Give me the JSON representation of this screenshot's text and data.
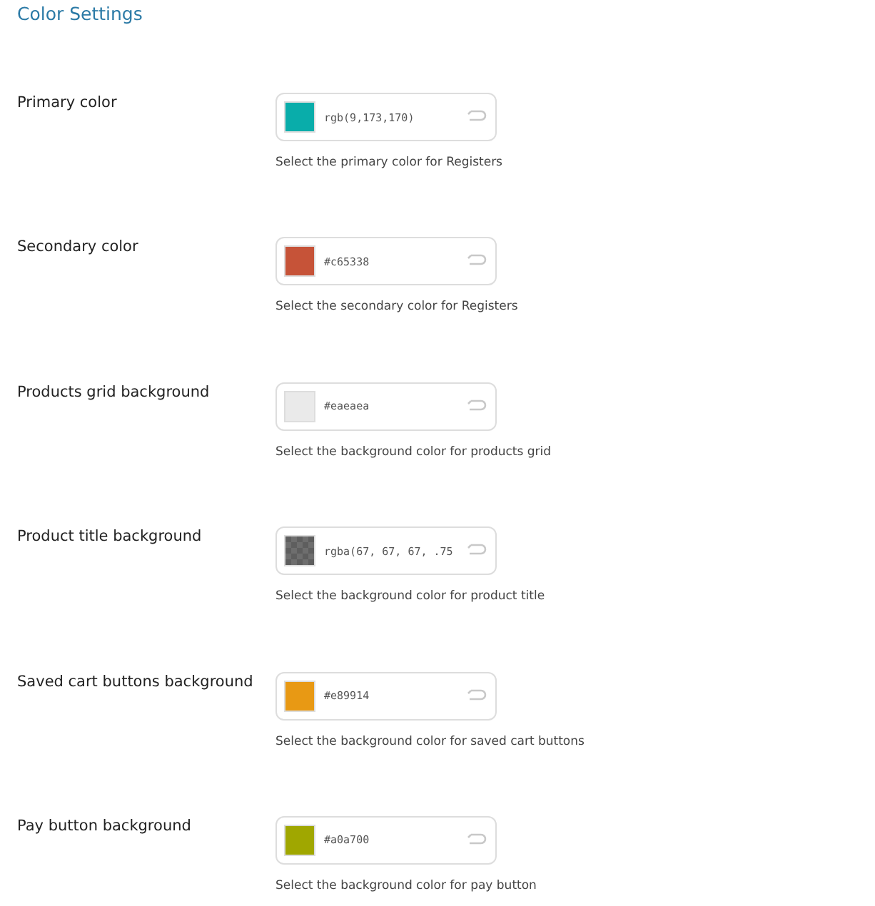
{
  "section_title": "Color Settings",
  "settings": [
    {
      "label": "Primary color",
      "value": "rgb(9,173,170)",
      "color": "#09adaa",
      "kind": "solid",
      "description": "Select the primary color for Registers"
    },
    {
      "label": "Secondary color",
      "value": "#c65338",
      "color": "#c65338",
      "kind": "solid",
      "description": "Select the secondary color for Registers"
    },
    {
      "label": "Products grid background",
      "value": "#eaeaea",
      "color": "#eaeaea",
      "kind": "solid",
      "description": "Select the background color for products grid"
    },
    {
      "label": "Product title background",
      "value": "rgba(67, 67, 67, .75",
      "color": "#5e5e5e",
      "kind": "translucent",
      "description": "Select the background color for product title"
    },
    {
      "label": "Saved cart buttons background",
      "value": "#e89914",
      "color": "#e89914",
      "kind": "solid",
      "description": "Select the background color for saved cart buttons"
    },
    {
      "label": "Pay button background",
      "value": "#a0a700",
      "color": "#a0a700",
      "kind": "solid",
      "description": "Select the background color for pay button"
    }
  ]
}
